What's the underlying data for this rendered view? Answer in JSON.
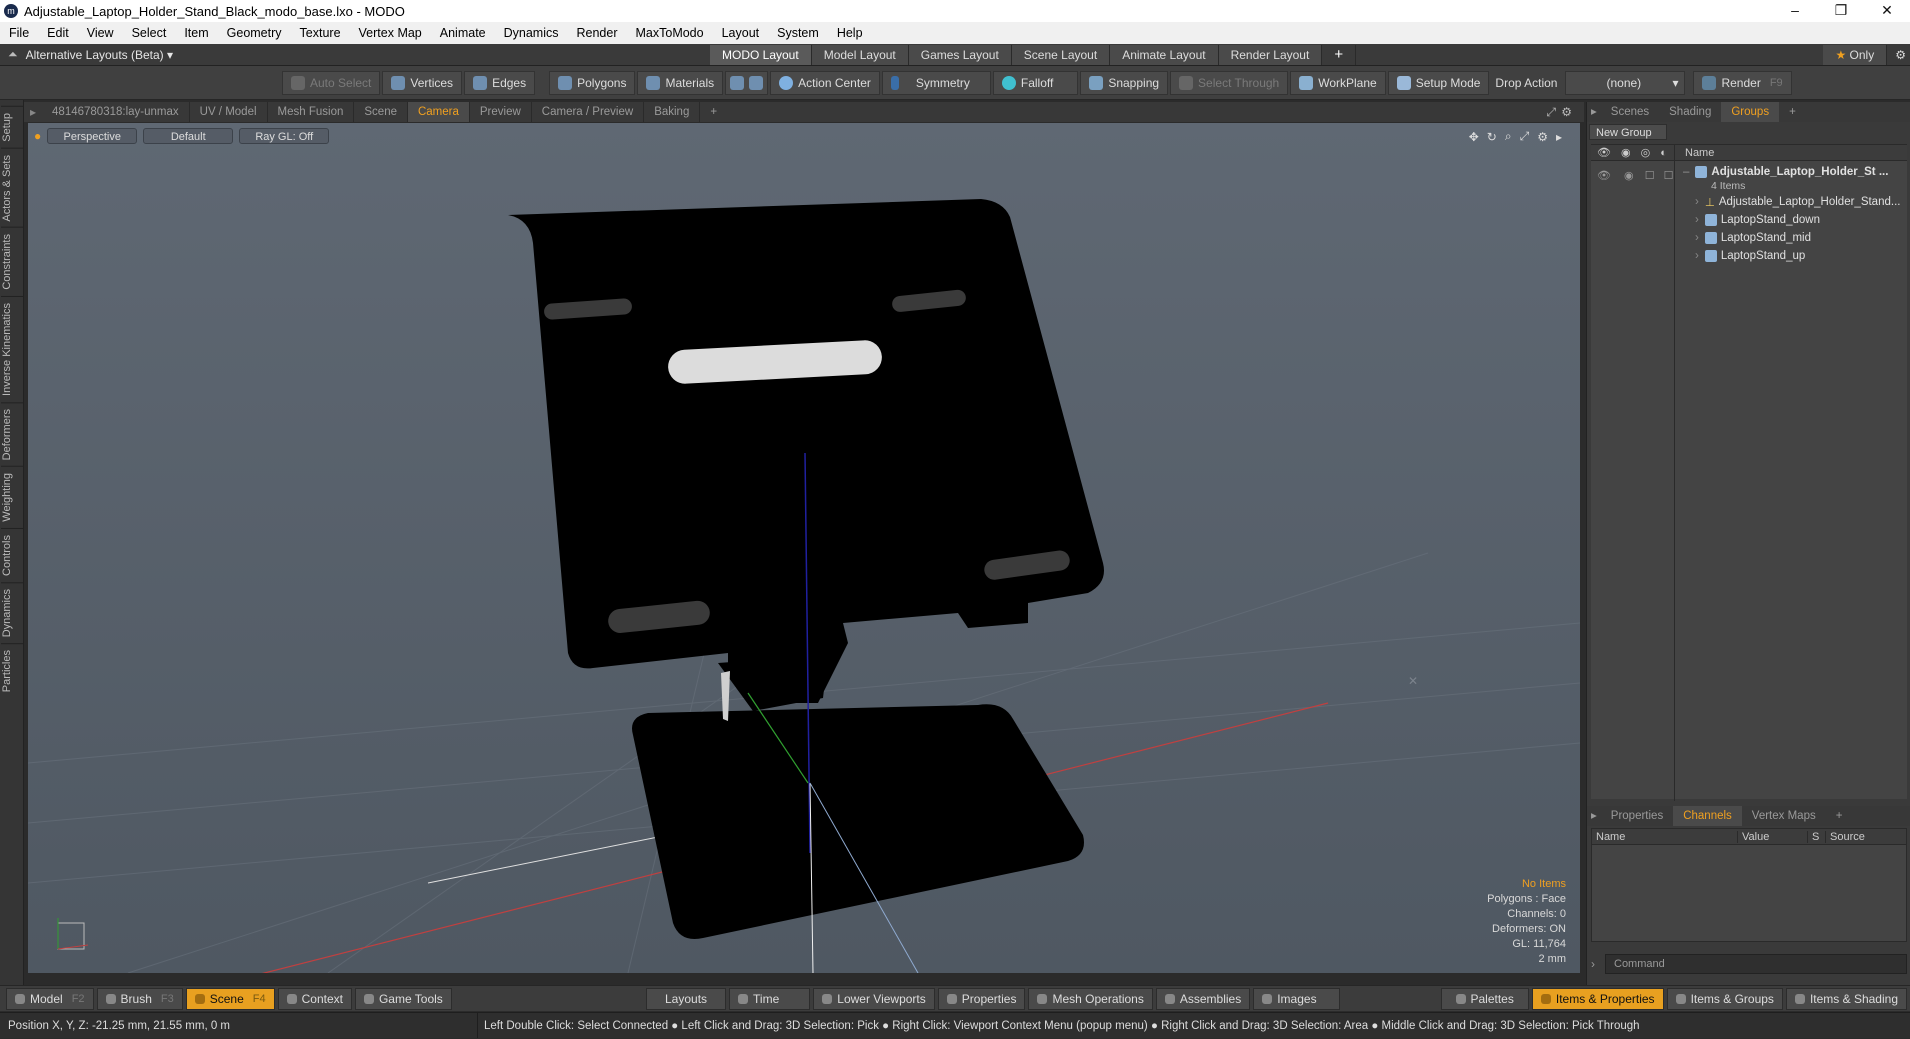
{
  "window": {
    "title": "Adjustable_Laptop_Holder_Stand_Black_modo_base.lxo - MODO",
    "icon_text": "m"
  },
  "menu": [
    "File",
    "Edit",
    "View",
    "Select",
    "Item",
    "Geometry",
    "Texture",
    "Vertex Map",
    "Animate",
    "Dynamics",
    "Render",
    "MaxToModo",
    "Layout",
    "System",
    "Help"
  ],
  "layouts": {
    "alt_label": "Alternative Layouts (Beta)",
    "tabs": [
      "MODO Layout",
      "Model Layout",
      "Games Layout",
      "Scene Layout",
      "Animate Layout",
      "Render Layout"
    ],
    "plus": "+",
    "only_label": "Only"
  },
  "toolbar": {
    "auto_select": "Auto Select",
    "vertices": "Vertices",
    "edges": "Edges",
    "polygons": "Polygons",
    "materials": "Materials",
    "action_center": "Action Center",
    "symmetry": "Symmetry",
    "falloff": "Falloff",
    "snapping": "Snapping",
    "select_through": "Select Through",
    "workplane": "WorkPlane",
    "setup_mode": "Setup Mode",
    "drop_action": "Drop Action",
    "drop_value": "(none)",
    "render": "Render",
    "render_key": "F9"
  },
  "left_tabs": [
    "Setup",
    "Actors & Sets",
    "Constraints",
    "Inverse Kinematics",
    "Deformers",
    "Weighting",
    "Controls",
    "Dynamics",
    "Particles"
  ],
  "viewport_tabs": [
    "48146780318:lay-unmax",
    "UV / Model",
    "Mesh Fusion",
    "Scene",
    "Camera",
    "Preview",
    "Camera / Preview",
    "Baking"
  ],
  "viewport_tab_active": "Camera",
  "viewport": {
    "perspective": "Perspective",
    "shading": "Default",
    "raygl": "Ray GL: Off",
    "info": {
      "no_items": "No Items",
      "polygons": "Polygons : Face",
      "channels": "Channels: 0",
      "deformers": "Deformers: ON",
      "gl": "GL: 11,764",
      "unit": "2 mm"
    }
  },
  "right_top_tabs": [
    "Scenes",
    "Shading",
    "Groups"
  ],
  "right_top_active": "Groups",
  "groups": {
    "new_group": "New Group",
    "name_col": "Name",
    "root": "Adjustable_Laptop_Holder_St ...",
    "root_count": "4 Items",
    "children": [
      "Adjustable_Laptop_Holder_Stand...",
      "LaptopStand_down",
      "LaptopStand_mid",
      "LaptopStand_up"
    ]
  },
  "right_bottom_tabs": [
    "Properties",
    "Channels",
    "Vertex Maps"
  ],
  "right_bottom_active": "Channels",
  "channels_cols": [
    "Name",
    "Value",
    "S",
    "Source"
  ],
  "command_placeholder": "Command",
  "bottom_left": [
    {
      "label": "Model",
      "key": "F2"
    },
    {
      "label": "Brush",
      "key": "F3"
    },
    {
      "label": "Scene",
      "key": "F4"
    },
    {
      "label": "Context",
      "key": ""
    },
    {
      "label": "Game Tools",
      "key": ""
    }
  ],
  "bottom_mid": [
    "Layouts",
    "Time",
    "Lower Viewports",
    "Properties",
    "Mesh Operations",
    "Assemblies",
    "Images"
  ],
  "bottom_right": [
    "Palettes",
    "Items & Properties",
    "Items & Groups",
    "Items & Shading"
  ],
  "status": {
    "position": "Position X, Y, Z:   -21.25 mm, 21.55 mm, 0 m",
    "hints": "Left Double Click: Select Connected ● Left Click and Drag: 3D Selection: Pick ● Right Click: Viewport Context Menu (popup menu) ● Right Click and Drag: 3D Selection: Area ● Middle Click and Drag: 3D Selection: Pick Through"
  },
  "colors": {
    "accent": "#f0a020",
    "active_button": "#e8a020"
  }
}
